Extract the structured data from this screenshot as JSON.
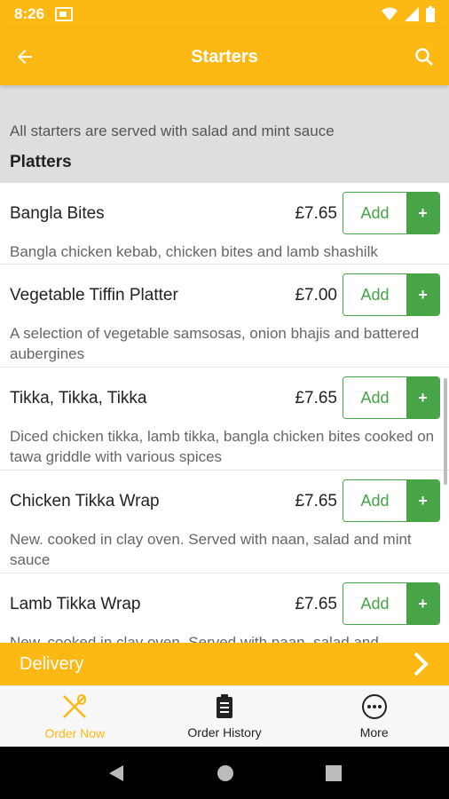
{
  "status_bar": {
    "time": "8:26"
  },
  "app_bar": {
    "title": "Starters"
  },
  "info": {
    "note": "All starters are served with salad and mint sauce",
    "section": "Platters"
  },
  "items": [
    {
      "name": "Bangla Bites",
      "price": "£7.65",
      "add_label": "Add",
      "plus": "+",
      "description": "Bangla chicken kebab, chicken bites and lamb shashilk"
    },
    {
      "name": "Vegetable Tiffin Platter",
      "price": "£7.00",
      "add_label": "Add",
      "plus": "+",
      "description": "A selection of vegetable samsosas, onion bhajis and battered aubergines"
    },
    {
      "name": "Tikka, Tikka, Tikka",
      "price": "£7.65",
      "add_label": "Add",
      "plus": "+",
      "description": "Diced chicken tikka, lamb tikka, bangla chicken bites cooked on tawa griddle with various spices"
    },
    {
      "name": "Chicken Tikka Wrap",
      "price": "£7.65",
      "add_label": "Add",
      "plus": "+",
      "description": "New. cooked in clay oven. Served with naan, salad and mint sauce"
    },
    {
      "name": "Lamb Tikka Wrap",
      "price": "£7.65",
      "add_label": "Add",
      "plus": "+",
      "description": "New. cooked in clay oven. Served with naan, salad and"
    }
  ],
  "delivery": {
    "label": "Delivery"
  },
  "bottom_nav": [
    {
      "label": "Order Now",
      "icon": "utensils-icon",
      "active": true
    },
    {
      "label": "Order History",
      "icon": "clipboard-icon",
      "active": false
    },
    {
      "label": "More",
      "icon": "more-icon",
      "active": false
    }
  ],
  "colors": {
    "accent": "#FDB813",
    "green": "#47a447"
  }
}
